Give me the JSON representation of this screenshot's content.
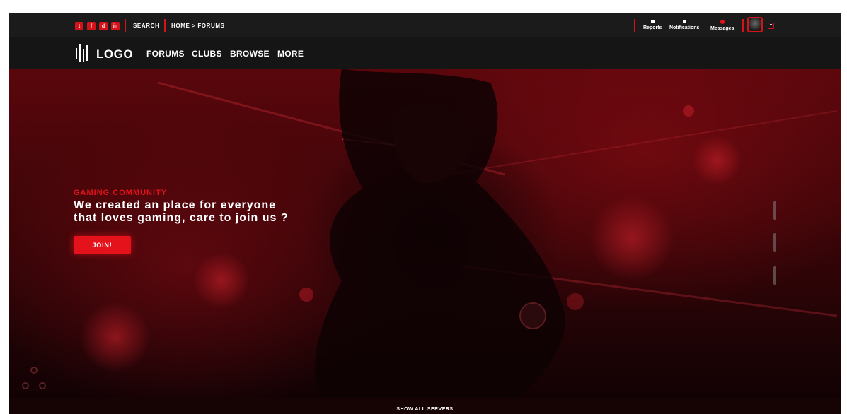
{
  "topbar": {
    "social": [
      {
        "icon": "twitter-icon",
        "glyph": "t"
      },
      {
        "icon": "facebook-icon",
        "glyph": "f"
      },
      {
        "icon": "discord-icon",
        "glyph": "d"
      },
      {
        "icon": "linkedin-icon",
        "glyph": "in"
      }
    ],
    "search_label": "SEARCH",
    "breadcrumb": "HOME > FORUMS",
    "notifications": [
      {
        "label": "Reports"
      },
      {
        "label": "Notifications"
      },
      {
        "label": "Messages"
      }
    ]
  },
  "nav": {
    "logo_text": "LOGO",
    "items": [
      "FORUMS",
      "CLUBS",
      "BROWSE",
      "MORE"
    ]
  },
  "hero": {
    "kicker": "GAMING COMMUNITY",
    "line1": "We created an place for everyone",
    "line2": "that loves gaming, care to join us ?",
    "cta": "JOIN!"
  },
  "footer": {
    "show_all": "SHOW ALL SERVERS"
  },
  "colors": {
    "accent": "#e3121b",
    "topbar_bg": "#1b1b1c",
    "nav_bg": "#151516"
  }
}
